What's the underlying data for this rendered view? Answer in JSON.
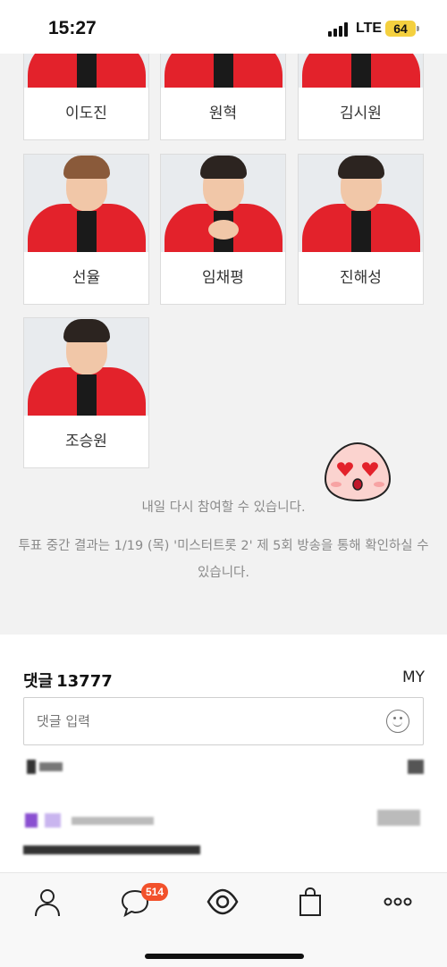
{
  "status_bar": {
    "time": "15:27",
    "network": "LTE",
    "battery": "64"
  },
  "candidates": [
    {
      "name": "이도진",
      "hair": "dark"
    },
    {
      "name": "원혁",
      "hair": "dark"
    },
    {
      "name": "김시원",
      "hair": "dark"
    },
    {
      "name": "선율",
      "hair": "brown"
    },
    {
      "name": "임채평",
      "hair": "dark"
    },
    {
      "name": "진해성",
      "hair": "dark"
    },
    {
      "name": "조승원",
      "hair": "dark"
    }
  ],
  "messages": {
    "retry": "내일 다시 참여할 수 있습니다.",
    "result": "투표 중간 결과는 1/19 (목) '미스터트롯 2' 제 5회 방송을 통해 확인하실 수 있습니다."
  },
  "comments": {
    "title": "댓글",
    "count": "13777",
    "my_label": "MY",
    "input_placeholder": "댓글 입력"
  },
  "tabbar": {
    "items": [
      "profile-icon",
      "chat-icon",
      "eye-icon",
      "shopping-bag-icon",
      "more-icon"
    ],
    "chat_badge": "514"
  },
  "colors": {
    "accent": "#f2512b",
    "jacket": "#e3222b",
    "battery": "#f4d03f"
  }
}
